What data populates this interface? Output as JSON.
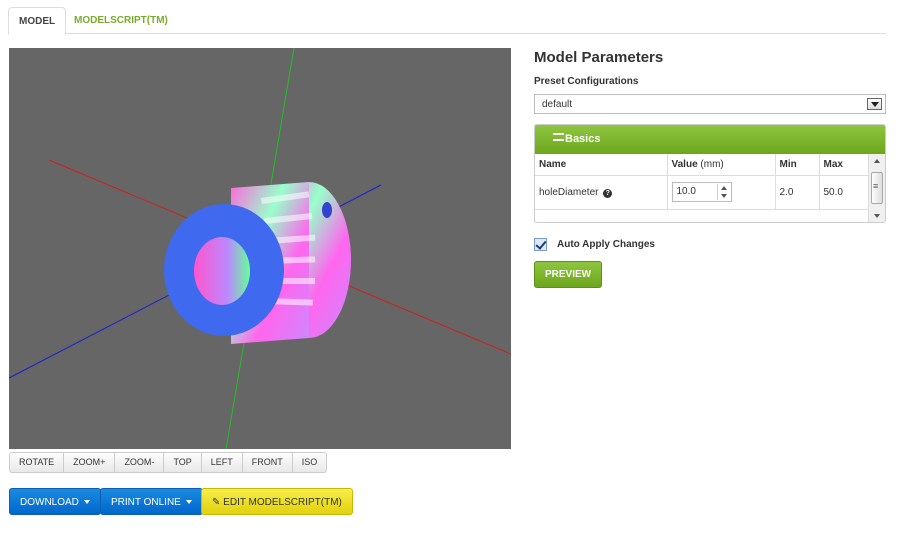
{
  "tabs": [
    {
      "label": "MODEL"
    },
    {
      "label": "MODELSCRIPT(TM)"
    }
  ],
  "viewport": {
    "background": "#666666",
    "axis_colors": {
      "x": "#d02020",
      "y": "#20c020",
      "z": "#2020d0"
    }
  },
  "view_buttons": [
    "ROTATE",
    "ZOOM+",
    "ZOOM-",
    "TOP",
    "LEFT",
    "FRONT",
    "ISO"
  ],
  "actions": {
    "download": "DOWNLOAD",
    "print_online": "PRINT ONLINE",
    "edit_script": "EDIT MODELSCRIPT(TM)"
  },
  "params": {
    "title": "Model Parameters",
    "preset_label": "Preset Configurations",
    "preset_value": "default",
    "section_title": "Basics",
    "columns": {
      "name": "Name",
      "value": "Value",
      "unit": "(mm)",
      "min": "Min",
      "max": "Max"
    },
    "rows": [
      {
        "name": "holeDiameter",
        "value": "10.0",
        "min": "2.0",
        "max": "50.0"
      }
    ],
    "auto_apply_label": "Auto Apply Changes",
    "auto_apply_checked": true,
    "preview_label": "PREVIEW"
  },
  "colors": {
    "green": "#7ab32e",
    "blue": "#0a75d8",
    "yellow": "#efe02a"
  }
}
